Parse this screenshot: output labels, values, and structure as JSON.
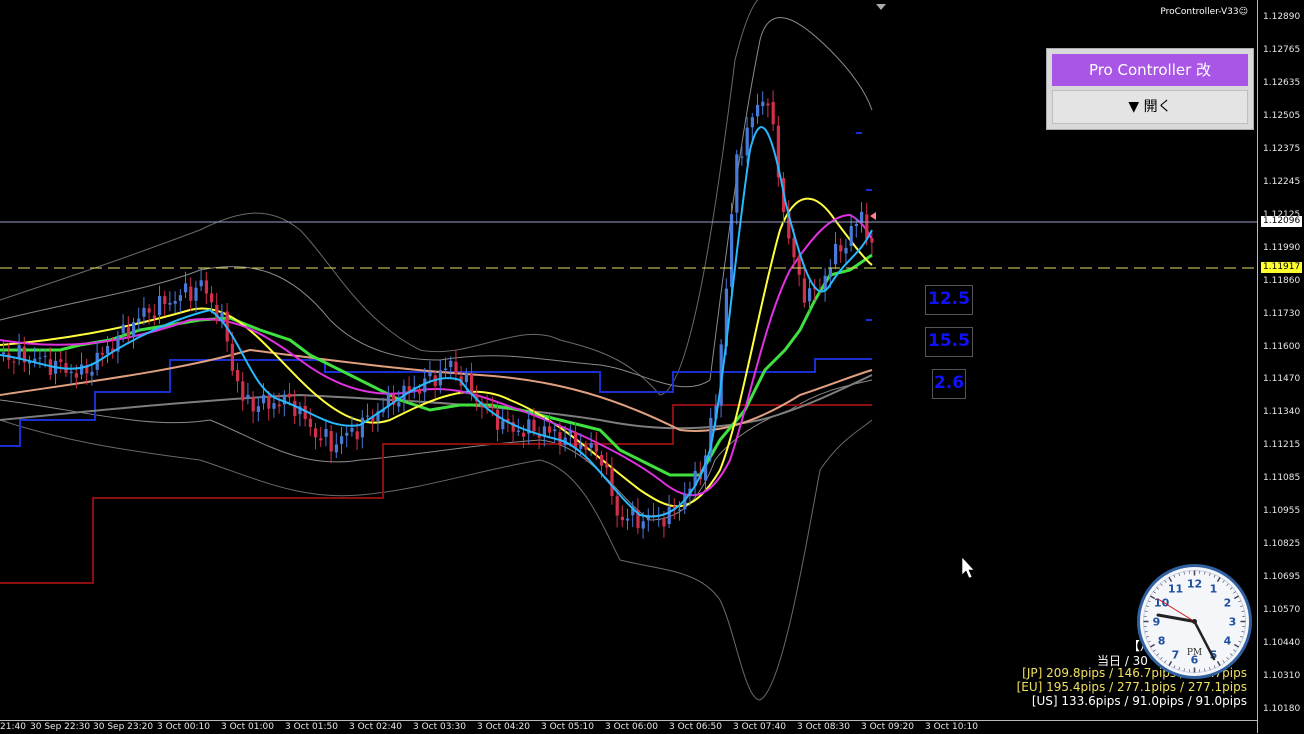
{
  "version_label": "ProController-V33☺",
  "panel": {
    "title": "Pro Controller 改",
    "open_label": "▼ 開く"
  },
  "value_boxes": [
    "12.5",
    "15.5",
    "2.6"
  ],
  "price_scale": [
    "1.12890",
    "1.12765",
    "1.12635",
    "1.12505",
    "1.12375",
    "1.12245",
    "1.12125",
    "1.11990",
    "1.11860",
    "1.11730",
    "1.11600",
    "1.11470",
    "1.11340",
    "1.11215",
    "1.11085",
    "1.10955",
    "1.10825",
    "1.10695",
    "1.10570",
    "1.10440",
    "1.10310",
    "1.10180"
  ],
  "current_price": "1.12096",
  "line_price": "1.11917",
  "time_axis": [
    "21:40",
    "30 Sep 22:30",
    "30 Sep 23:20",
    "3 Oct 00:10",
    "3 Oct 01:00",
    "3 Oct 01:50",
    "3 Oct 02:40",
    "3 Oct 03:30",
    "3 Oct 04:20",
    "3 Oct 05:10",
    "3 Oct 06:00",
    "3 Oct 06:50",
    "3 Oct 07:40",
    "3 Oct 08:30",
    "3 Oct 09:20",
    "3 Oct 10:10"
  ],
  "stats": {
    "header": "【⽉",
    "day_line": "当日 / 30",
    "jp": "[JP] 209.8pips / 146.7pips / 146.7pips",
    "eu": "[EU] 195.4pips / 277.1pips / 277.1pips",
    "us": "[US] 133.6pips / 91.0pips / 91.0pips"
  },
  "clock": {
    "numbers": [
      "12",
      "1",
      "2",
      "3",
      "4",
      "5",
      "6",
      "7",
      "8",
      "9",
      "10",
      "11"
    ],
    "label": "PM"
  },
  "colors": {
    "panel_accent": "#a956e6",
    "value_box_text": "#1010ff",
    "jp": "#f0e060",
    "eu": "#f0e060",
    "us": "#ffffff"
  }
}
